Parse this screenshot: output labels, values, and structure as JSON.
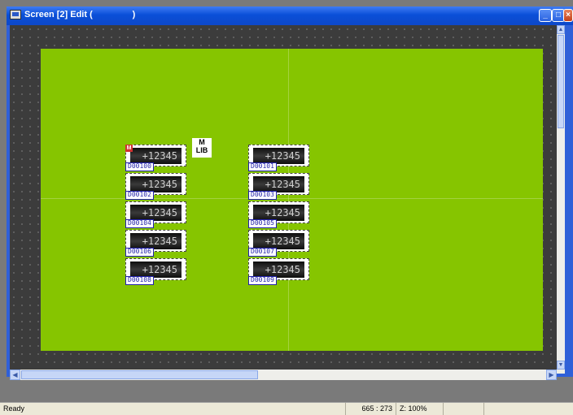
{
  "window": {
    "title": "Screen [2] Edit (                )",
    "controls": {
      "minimize": "_",
      "maximize": "□",
      "close": "×"
    }
  },
  "mlib_badge": {
    "line1": "M",
    "line2": "LIB"
  },
  "displays": [
    {
      "value": "+12345",
      "address": "D00100",
      "column": 0,
      "row": 0
    },
    {
      "value": "+12345",
      "address": "D00101",
      "column": 1,
      "row": 0
    },
    {
      "value": "+12345",
      "address": "D00102",
      "column": 0,
      "row": 1
    },
    {
      "value": "+12345",
      "address": "D00103",
      "column": 1,
      "row": 1
    },
    {
      "value": "+12345",
      "address": "D00104",
      "column": 0,
      "row": 2
    },
    {
      "value": "+12345",
      "address": "D00105",
      "column": 1,
      "row": 2
    },
    {
      "value": "+12345",
      "address": "D00106",
      "column": 0,
      "row": 3
    },
    {
      "value": "+12345",
      "address": "D00107",
      "column": 1,
      "row": 3
    },
    {
      "value": "+12345",
      "address": "D00108",
      "column": 0,
      "row": 4
    },
    {
      "value": "+12345",
      "address": "D00109",
      "column": 1,
      "row": 4
    }
  ],
  "first_display_badge": "M",
  "statusbar": {
    "status": "Ready",
    "coordinates": "665 : 273",
    "zoom": "Z: 100%"
  },
  "colors": {
    "screen_background": "#86c500",
    "title_bar": "#0a4fd8",
    "address_tag": "#2222aa"
  },
  "icons": {
    "app": "screen-window-icon",
    "scroll_up": "arrow-up-icon",
    "scroll_down": "arrow-down-icon",
    "scroll_left": "arrow-left-icon",
    "scroll_right": "arrow-right-icon"
  }
}
